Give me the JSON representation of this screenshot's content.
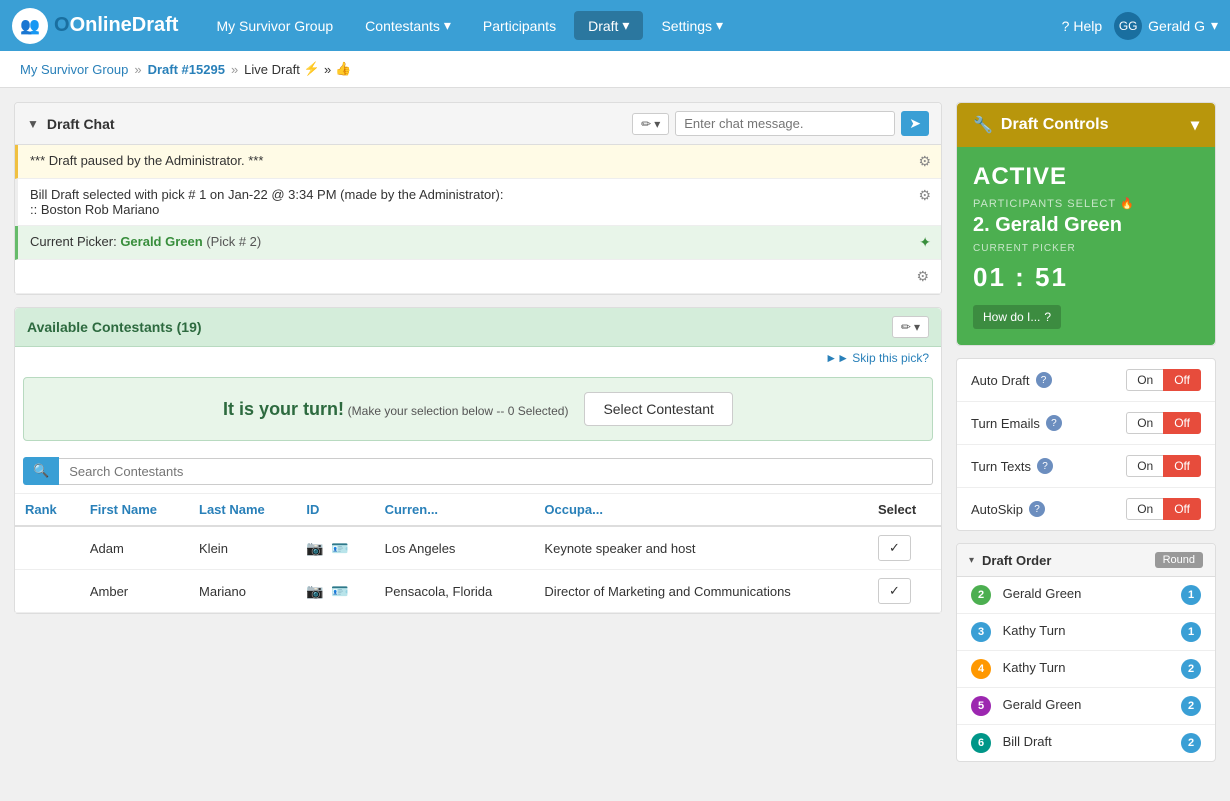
{
  "app": {
    "title": "OnlineDraft",
    "icon": "👥"
  },
  "navbar": {
    "brand": "nlineDraft",
    "links": [
      {
        "label": "My Survivor Group",
        "active": false
      },
      {
        "label": "Contestants",
        "dropdown": true,
        "active": false
      },
      {
        "label": "Participants",
        "active": false
      },
      {
        "label": "Draft",
        "dropdown": true,
        "active": true
      },
      {
        "label": "Settings",
        "dropdown": true,
        "active": false
      }
    ],
    "help_label": "Help",
    "user_label": "Gerald G",
    "user_initials": "GG"
  },
  "breadcrumb": {
    "group_label": "My Survivor Group",
    "draft_label": "Draft #15295",
    "current_label": "Live Draft",
    "emoji": "⚡",
    "thumbs": "👍"
  },
  "draft_chat": {
    "title": "Draft Chat",
    "messages": [
      {
        "text": "*** Draft paused by the Administrator. ***",
        "type": "paused"
      },
      {
        "text": "Bill Draft selected with pick # 1 on Jan-22 @ 3:34 PM (made by the Administrator):\n:: Boston Rob Mariano",
        "type": "selected"
      },
      {
        "text": "Current Picker: Gerald Green (Pick # 2)",
        "type": "current",
        "name": "Gerald Green",
        "pick": "(Pick # 2)"
      }
    ],
    "chat_placeholder": "Enter chat message.",
    "pencil_icon": "✏",
    "send_icon": "➤",
    "gear_icon": "⚙"
  },
  "contestants": {
    "title": "Available Contestants (19)",
    "skip_link": "►► Skip this pick?",
    "your_turn_text": "It is your turn!",
    "your_turn_sub": "(Make your selection below -- 0 Selected)",
    "select_btn_label": "Select Contestant",
    "search_placeholder": "Search Contestants",
    "columns": [
      "Rank",
      "First Name",
      "Last Name",
      "ID",
      "Curren...",
      "Occupa...",
      "Select"
    ],
    "rows": [
      {
        "rank": "",
        "first_name": "Adam",
        "last_name": "Klein",
        "id": "",
        "current": "Los Angeles",
        "occupation": "Keynote speaker and host",
        "select": "✓"
      },
      {
        "rank": "",
        "first_name": "Amber",
        "last_name": "Mariano",
        "id": "",
        "current": "Pensacola, Florida",
        "occupation": "Director of Marketing and Communications",
        "select": "✓"
      }
    ]
  },
  "draft_controls": {
    "title": "Draft Controls",
    "caret_icon": "▾",
    "wrench_icon": "🔧",
    "status": "ACTIVE",
    "participants_label": "PARTICIPANTS SELECT",
    "fire_icon": "🔥",
    "current_picker": "2. Gerald Green",
    "current_picker_label": "CURRENT PICKER",
    "timer": "01 : 51",
    "how_do_i_label": "How do I...",
    "help_icon": "?"
  },
  "settings": {
    "auto_draft_label": "Auto Draft",
    "turn_emails_label": "Turn Emails",
    "turn_texts_label": "Turn Texts",
    "auto_skip_label": "AutoSkip",
    "on_label": "On",
    "off_label": "Off"
  },
  "draft_order": {
    "title": "Draft Order",
    "round_label": "Round",
    "toggle_icon": "▾",
    "pickers": [
      {
        "num": "2",
        "name": "Gerald Green",
        "round": "1",
        "color": "green"
      },
      {
        "num": "3",
        "name": "Kathy Turn",
        "round": "1",
        "color": "blue"
      },
      {
        "num": "4",
        "name": "Kathy Turn",
        "round": "2",
        "color": "orange"
      },
      {
        "num": "5",
        "name": "Gerald Green",
        "round": "2",
        "color": "purple"
      },
      {
        "num": "6",
        "name": "Bill Draft",
        "round": "2",
        "color": "teal"
      }
    ]
  }
}
